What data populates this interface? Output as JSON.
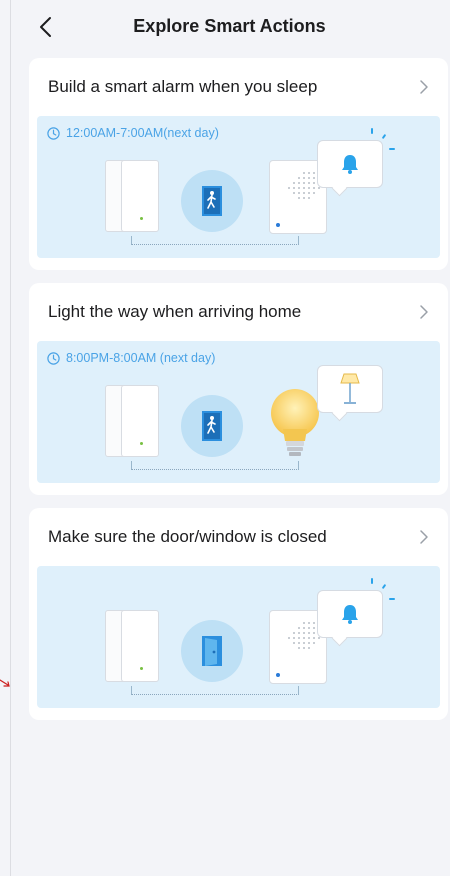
{
  "header": {
    "title": "Explore Smart Actions",
    "back_icon": "chevron-left-icon"
  },
  "cards": [
    {
      "title": "Build a smart alarm when you sleep",
      "time": "12:00AM-7:00AM(next day)",
      "action": "alarm"
    },
    {
      "title": "Light the way when arriving home",
      "time": "8:00PM-8:00AM (next day)",
      "action": "light"
    },
    {
      "title": "Make sure the door/window is closed",
      "time": "",
      "action": "alarm"
    }
  ],
  "colors": {
    "accent": "#2aa3ea",
    "scene_bg": "#dff0fb",
    "time_text": "#4aa3e6",
    "annotation_arrow": "#cc1f1f"
  }
}
